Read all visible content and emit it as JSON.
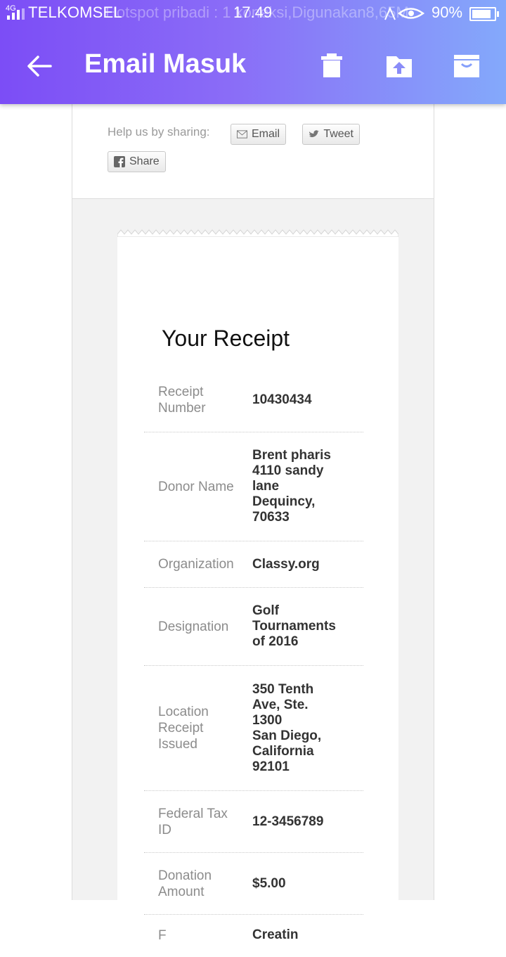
{
  "status_bar": {
    "network": "4G",
    "carrier": "TELKOMSEL",
    "hotspot": "Hotspot pribadi : 1 koneksi,Digunakan8,65M",
    "time": "17.49",
    "battery": "90%"
  },
  "app_bar": {
    "title": "Email Masuk",
    "icons": [
      "back-arrow-icon",
      "trash-icon",
      "move-to-folder-icon",
      "archive-icon"
    ]
  },
  "share": {
    "label": "Help us by sharing:",
    "email": "Email",
    "tweet": "Tweet",
    "share": "Share"
  },
  "receipt": {
    "title": "Your Receipt",
    "rows": [
      {
        "label": "Receipt\nNumber",
        "value": "10430434"
      },
      {
        "label": "Donor Name",
        "value": "Brent pharis\n4110 sandy\nlane\nDequincy,\n70633"
      },
      {
        "label": "Organization",
        "value": "Classy.org"
      },
      {
        "label": "Designation",
        "value": "Golf\nTournaments\nof 2016"
      },
      {
        "label": "Location\nReceipt\nIssued",
        "value": "350 Tenth\nAve, Ste.\n1300\nSan Diego,\nCalifornia\n92101"
      },
      {
        "label": "Federal Tax\nID",
        "value": "12-3456789"
      },
      {
        "label": "Donation\nAmount",
        "value": "$5.00"
      },
      {
        "label": "F",
        "value": "Creatin"
      }
    ]
  }
}
